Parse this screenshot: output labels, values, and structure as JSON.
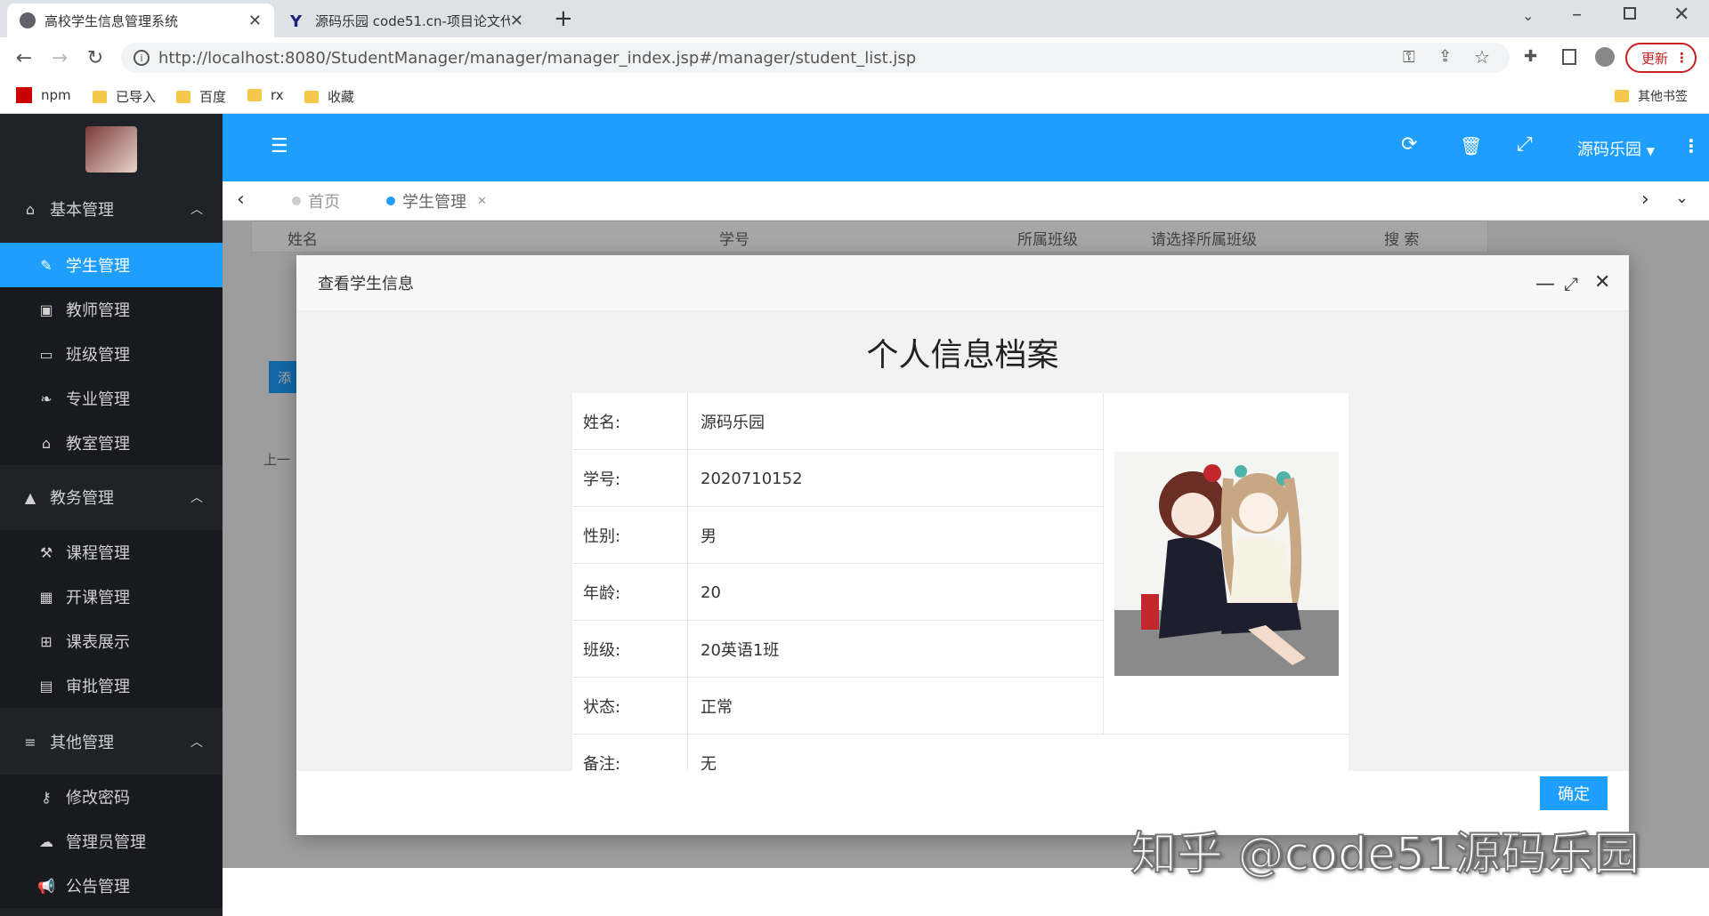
{
  "browser": {
    "tabs": [
      {
        "title": "高校学生信息管理系统",
        "active": true
      },
      {
        "title": "源码乐园 code51.cn-项目论文代",
        "active": false
      }
    ],
    "url": "http://localhost:8080/StudentManager/manager/manager_index.jsp#/manager/student_list.jsp",
    "update_label": "更新",
    "bookmarks": [
      "npm",
      "已导入",
      "百度",
      "rx",
      "收藏"
    ],
    "other_bookmarks": "其他书签"
  },
  "sidebar": {
    "groups": [
      {
        "label": "基本管理",
        "icon": "home-icon",
        "items": [
          {
            "label": "学生管理",
            "icon": "pencil-icon",
            "active": true
          },
          {
            "label": "教师管理",
            "icon": "briefcase-icon"
          },
          {
            "label": "班级管理",
            "icon": "window-icon"
          },
          {
            "label": "专业管理",
            "icon": "leaf-icon"
          },
          {
            "label": "教室管理",
            "icon": "bank-icon"
          }
        ]
      },
      {
        "label": "教务管理",
        "icon": "graduation-cap-icon",
        "items": [
          {
            "label": "课程管理",
            "icon": "gavel-icon"
          },
          {
            "label": "开课管理",
            "icon": "calendar-icon"
          },
          {
            "label": "课表展示",
            "icon": "table-icon"
          },
          {
            "label": "审批管理",
            "icon": "book-icon"
          }
        ]
      },
      {
        "label": "其他管理",
        "icon": "menu-icon",
        "items": [
          {
            "label": "修改密码",
            "icon": "key-icon"
          },
          {
            "label": "管理员管理",
            "icon": "cloud-icon"
          },
          {
            "label": "公告管理",
            "icon": "bullhorn-icon"
          }
        ]
      }
    ]
  },
  "topbar": {
    "user": "源码乐园"
  },
  "page_tabs": [
    {
      "label": "首页"
    },
    {
      "label": "学生管理",
      "active": true
    }
  ],
  "search_form": {
    "name_label": "姓名",
    "number_label": "学号",
    "class_label": "所属班级",
    "class_placeholder": "请选择所属班级",
    "search_button": "搜 索"
  },
  "list": {
    "add_label": "添",
    "prev_label": "上一"
  },
  "modal": {
    "title": "查看学生信息",
    "doc_title": "个人信息档案",
    "rows": [
      {
        "label": "姓名:",
        "value": "源码乐园"
      },
      {
        "label": "学号:",
        "value": "2020710152"
      },
      {
        "label": "性别:",
        "value": "男"
      },
      {
        "label": "年龄:",
        "value": "20"
      },
      {
        "label": "班级:",
        "value": "20英语1班"
      },
      {
        "label": "状态:",
        "value": "正常"
      },
      {
        "label": "备注:",
        "value": "无"
      }
    ],
    "ok_label": "确定"
  },
  "watermark": "知乎 @code51源码乐园",
  "colors": {
    "accent": "#1e9fff",
    "sidebar": "#20222a",
    "danger": "#ff5722"
  }
}
